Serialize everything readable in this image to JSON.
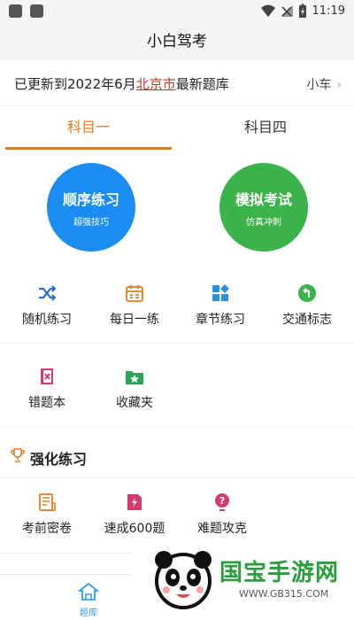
{
  "status_bar": {
    "time": "11:19"
  },
  "header": {
    "title": "小白驾考"
  },
  "notice": {
    "prefix": "已更新到2022年6月",
    "city": "北京市",
    "suffix": "最新题库",
    "vehicle": "小车",
    "chevron": "›"
  },
  "tabs": [
    {
      "label": "科目一",
      "active": true
    },
    {
      "label": "科目四",
      "active": false
    }
  ],
  "big_buttons": [
    {
      "title": "顺序练习",
      "subtitle": "超强技巧",
      "color": "#1a8cf2"
    },
    {
      "title": "模拟考试",
      "subtitle": "仿真冲刺",
      "color": "#3cb24a"
    }
  ],
  "grid_row1": [
    {
      "label": "随机练习",
      "icon": "shuffle-icon"
    },
    {
      "label": "每日一练",
      "icon": "calendar-icon"
    },
    {
      "label": "章节练习",
      "icon": "chapters-icon"
    },
    {
      "label": "交通标志",
      "icon": "traffic-sign-icon"
    }
  ],
  "grid_row2": [
    {
      "label": "错题本",
      "icon": "wrong-book-icon"
    },
    {
      "label": "收藏夹",
      "icon": "favorites-folder-icon"
    }
  ],
  "section": {
    "title": "强化练习"
  },
  "grid_row3": [
    {
      "label": "考前密卷",
      "icon": "exam-paper-icon"
    },
    {
      "label": "速成600题",
      "icon": "quick-600-icon"
    },
    {
      "label": "难题攻克",
      "icon": "hard-question-icon"
    }
  ],
  "bottom_nav": {
    "home_label": "题库"
  },
  "watermark": {
    "brand": "国宝手游网",
    "url": "WWW.GB315.COM"
  },
  "colors": {
    "accent": "#e07b22",
    "blue": "#1a8cf2",
    "green": "#3cb24a",
    "link_red": "#c0392b"
  }
}
